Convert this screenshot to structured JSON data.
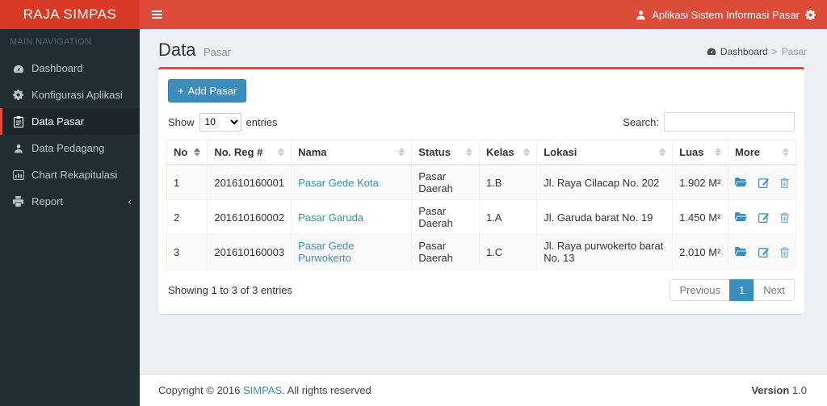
{
  "colors": {
    "accent_red": "#dd4b39",
    "primary_blue": "#3c8dbc",
    "sidebar_dark": "#222d32"
  },
  "navbar": {
    "brand": "RAJA SIMPAS",
    "user_label": "Aplikasi Sistem Informasi Pasar"
  },
  "sidebar": {
    "header": "MAIN NAVIGATION",
    "items": [
      {
        "label": "Dashboard"
      },
      {
        "label": "Konfigurasi Aplikasi"
      },
      {
        "label": "Data Pasar"
      },
      {
        "label": "Data Pedagang"
      },
      {
        "label": "Chart Rekapitulasi"
      },
      {
        "label": "Report",
        "chevron": "‹"
      }
    ]
  },
  "page": {
    "title": "Data",
    "subtitle": "Pasar",
    "breadcrumb": {
      "home": "Dashboard",
      "separator": ">",
      "current": "Pasar"
    }
  },
  "toolbar": {
    "plus_glyph": "+",
    "add_label": "Add Pasar"
  },
  "table_controls": {
    "show_label": "Show",
    "page_length": "10",
    "entries_label": "entries",
    "search_label": "Search:",
    "search_value": ""
  },
  "table": {
    "columns": [
      "No",
      "No. Reg #",
      "Nama",
      "Status",
      "Kelas",
      "Lokasi",
      "Luas",
      "More"
    ],
    "rows": [
      {
        "no": "1",
        "reg": "201610160001",
        "nama": "Pasar Gede Kota",
        "status": "Pasar Daerah",
        "kelas": "1.B",
        "lokasi": "Jl. Raya Cilacap No. 202",
        "luas": "1.902 M²"
      },
      {
        "no": "2",
        "reg": "201610160002",
        "nama": "Pasar Garuda",
        "status": "Pasar Daerah",
        "kelas": "1.A",
        "lokasi": "Jl. Garuda barat No. 19",
        "luas": "1.450 M²"
      },
      {
        "no": "3",
        "reg": "201610160003",
        "nama": "Pasar Gede Purwokerto",
        "status": "Pasar Daerah",
        "kelas": "1.C",
        "lokasi": "Jl. Raya purwokerto barat No. 13",
        "luas": "2.010 M²"
      }
    ]
  },
  "table_footer": {
    "info": "Showing 1 to 3 of 3 entries",
    "pagination": {
      "previous": "Previous",
      "page": "1",
      "next": "Next"
    }
  },
  "footer": {
    "copyright_prefix": "Copyright © 2016 ",
    "brand_link": "SIMPAS",
    "copyright_suffix": ". All rights reserved",
    "version_label": "Version",
    "version_value": "1.0"
  }
}
